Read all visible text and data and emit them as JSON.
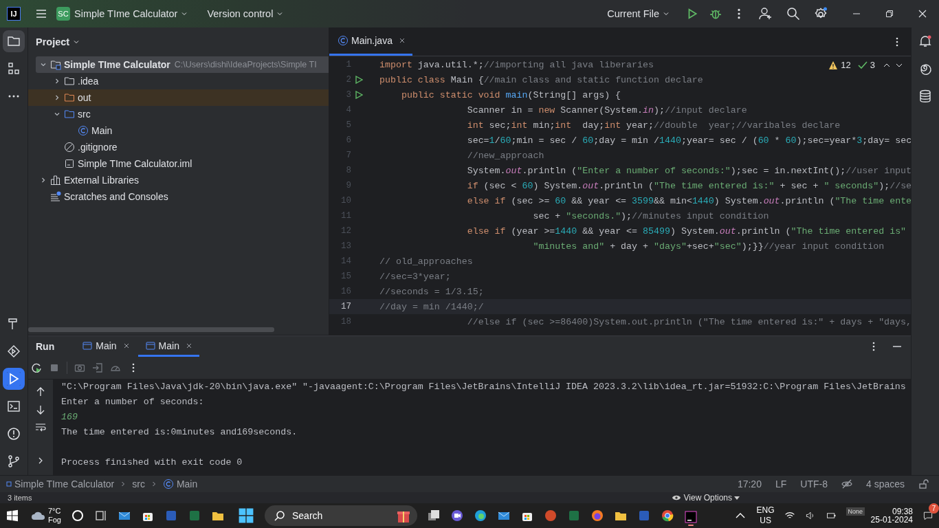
{
  "title_bar": {
    "logo": "IJ",
    "project_badge": "SC",
    "project": "Simple TIme Calculator",
    "vcs": "Version control",
    "run_config": "Current File"
  },
  "project_panel": {
    "title": "Project",
    "tree": [
      {
        "name": "Simple TIme Calculator",
        "path": "C:\\Users\\dishi\\IdeaProjects\\Simple TI",
        "kind": "module-root",
        "expanded": true,
        "selected": true,
        "children": [
          {
            "name": ".idea",
            "kind": "folder",
            "expanded": false,
            "selected": false
          },
          {
            "name": "out",
            "kind": "excluded",
            "expanded": false,
            "selected": false
          },
          {
            "name": "src",
            "kind": "source",
            "expanded": true,
            "selected": false,
            "children": [
              {
                "name": "Main",
                "kind": "class",
                "selected": false
              }
            ]
          },
          {
            "name": ".gitignore",
            "kind": "ignore",
            "selected": false
          },
          {
            "name": "Simple TIme Calculator.iml",
            "kind": "module",
            "selected": false
          }
        ]
      },
      {
        "name": "External Libraries",
        "kind": "libraries",
        "expanded": false,
        "selected": false
      },
      {
        "name": "Scratches and Consoles",
        "kind": "scratches",
        "selected": false
      }
    ]
  },
  "editor": {
    "tabs": [
      {
        "label": "Main.java",
        "selected": true
      }
    ],
    "inspections": {
      "warnings": "12",
      "passed": "3"
    },
    "lines": [
      {
        "n": "1",
        "runnable": false,
        "current": false,
        "tokens": [
          {
            "kind": "kw",
            "t": "import"
          },
          {
            "kind": "id",
            "t": " java.util.*;"
          },
          {
            "kind": "cm",
            "t": "//importing all java liberaries"
          }
        ]
      },
      {
        "n": "2",
        "runnable": true,
        "current": false,
        "tokens": [
          {
            "kind": "kw",
            "t": "public class "
          },
          {
            "kind": "id",
            "t": "Main {"
          },
          {
            "kind": "cm",
            "t": "//main class and static function declare"
          }
        ]
      },
      {
        "n": "3",
        "runnable": true,
        "current": false,
        "tokens": [
          {
            "kind": "kw",
            "t": "    public static void "
          },
          {
            "kind": "fn",
            "t": "main"
          },
          {
            "kind": "id",
            "t": "(String[] args) {"
          }
        ]
      },
      {
        "n": "4",
        "runnable": false,
        "current": false,
        "tokens": [
          {
            "kind": "id",
            "t": "                Scanner in = "
          },
          {
            "kind": "kw",
            "t": "new "
          },
          {
            "kind": "id",
            "t": "Scanner(System."
          },
          {
            "kind": "fld",
            "t": "in"
          },
          {
            "kind": "id",
            "t": ");"
          },
          {
            "kind": "cm",
            "t": "//input declare"
          }
        ]
      },
      {
        "n": "5",
        "runnable": false,
        "current": false,
        "tokens": [
          {
            "kind": "kw",
            "t": "                int "
          },
          {
            "kind": "id",
            "t": "sec;"
          },
          {
            "kind": "kw",
            "t": "int "
          },
          {
            "kind": "id",
            "t": "min;"
          },
          {
            "kind": "kw",
            "t": "int  "
          },
          {
            "kind": "id",
            "t": "day;"
          },
          {
            "kind": "kw",
            "t": "int "
          },
          {
            "kind": "id",
            "t": "year;"
          },
          {
            "kind": "cm",
            "t": "//double  year;//varibales declare"
          }
        ]
      },
      {
        "n": "6",
        "runnable": false,
        "current": false,
        "tokens": [
          {
            "kind": "id",
            "t": "                sec="
          },
          {
            "kind": "num",
            "t": "1"
          },
          {
            "kind": "id",
            "t": "/"
          },
          {
            "kind": "num",
            "t": "60"
          },
          {
            "kind": "id",
            "t": ";min = sec / "
          },
          {
            "kind": "num",
            "t": "60"
          },
          {
            "kind": "id",
            "t": ";day = min /"
          },
          {
            "kind": "num",
            "t": "1440"
          },
          {
            "kind": "id",
            "t": ";year= sec / ("
          },
          {
            "kind": "num",
            "t": "60"
          },
          {
            "kind": "id",
            "t": " * "
          },
          {
            "kind": "num",
            "t": "60"
          },
          {
            "kind": "id",
            "t": ");sec=year*"
          },
          {
            "kind": "num",
            "t": "3"
          },
          {
            "kind": "id",
            "t": ";day= sec"
          }
        ]
      },
      {
        "n": "7",
        "runnable": false,
        "current": false,
        "tokens": [
          {
            "kind": "cm",
            "t": "                //new_approach"
          }
        ]
      },
      {
        "n": "8",
        "runnable": false,
        "current": false,
        "tokens": [
          {
            "kind": "id",
            "t": "                System."
          },
          {
            "kind": "fld",
            "t": "out"
          },
          {
            "kind": "id",
            "t": ".println ("
          },
          {
            "kind": "str",
            "t": "\"Enter a number of seconds:\""
          },
          {
            "kind": "id",
            "t": ");sec = in.nextInt();"
          },
          {
            "kind": "cm",
            "t": "//user input"
          }
        ]
      },
      {
        "n": "9",
        "runnable": false,
        "current": false,
        "tokens": [
          {
            "kind": "kw",
            "t": "                if "
          },
          {
            "kind": "id",
            "t": "(sec < "
          },
          {
            "kind": "num",
            "t": "60"
          },
          {
            "kind": "id",
            "t": ") System."
          },
          {
            "kind": "fld",
            "t": "out"
          },
          {
            "kind": "id",
            "t": ".println ("
          },
          {
            "kind": "str",
            "t": "\"The time entered is:\""
          },
          {
            "kind": "id",
            "t": " + sec + "
          },
          {
            "kind": "str",
            "t": "\" seconds\""
          },
          {
            "kind": "id",
            "t": ");"
          },
          {
            "kind": "cm",
            "t": "//se"
          }
        ]
      },
      {
        "n": "10",
        "runnable": false,
        "current": false,
        "tokens": [
          {
            "kind": "kw",
            "t": "                else if "
          },
          {
            "kind": "id",
            "t": "(sec >= "
          },
          {
            "kind": "num",
            "t": "60"
          },
          {
            "kind": "id",
            "t": " && year <= "
          },
          {
            "kind": "num",
            "t": "3599"
          },
          {
            "kind": "id",
            "t": "&& min<"
          },
          {
            "kind": "num",
            "t": "1440"
          },
          {
            "kind": "id",
            "t": ") System."
          },
          {
            "kind": "fld",
            "t": "out"
          },
          {
            "kind": "id",
            "t": ".println ("
          },
          {
            "kind": "str",
            "t": "\"The time ente"
          }
        ]
      },
      {
        "n": "11",
        "runnable": false,
        "current": false,
        "tokens": [
          {
            "kind": "id",
            "t": "                            sec + "
          },
          {
            "kind": "str",
            "t": "\"seconds.\""
          },
          {
            "kind": "id",
            "t": ");"
          },
          {
            "kind": "cm",
            "t": "//minutes input condition"
          }
        ]
      },
      {
        "n": "12",
        "runnable": false,
        "current": false,
        "tokens": [
          {
            "kind": "kw",
            "t": "                else if "
          },
          {
            "kind": "id",
            "t": "(year >="
          },
          {
            "kind": "num",
            "t": "1440"
          },
          {
            "kind": "id",
            "t": " && year <= "
          },
          {
            "kind": "num",
            "t": "85499"
          },
          {
            "kind": "id",
            "t": ") System."
          },
          {
            "kind": "fld",
            "t": "out"
          },
          {
            "kind": "id",
            "t": ".println ("
          },
          {
            "kind": "str",
            "t": "\"The time entered is\""
          }
        ]
      },
      {
        "n": "13",
        "runnable": false,
        "current": false,
        "tokens": [
          {
            "kind": "str",
            "t": "                            \"minutes and\""
          },
          {
            "kind": "id",
            "t": " + day + "
          },
          {
            "kind": "str",
            "t": "\"days\""
          },
          {
            "kind": "id",
            "t": "+sec+"
          },
          {
            "kind": "str",
            "t": "\"sec\""
          },
          {
            "kind": "id",
            "t": ");}}"
          },
          {
            "kind": "cm",
            "t": "//year input condition"
          }
        ]
      },
      {
        "n": "14",
        "runnable": false,
        "current": false,
        "tokens": [
          {
            "kind": "cm",
            "t": "// old_approaches"
          }
        ]
      },
      {
        "n": "15",
        "runnable": false,
        "current": false,
        "tokens": [
          {
            "kind": "cm",
            "t": "//sec=3*year;"
          }
        ]
      },
      {
        "n": "16",
        "runnable": false,
        "current": false,
        "tokens": [
          {
            "kind": "cm",
            "t": "//seconds = 1/3.15;"
          }
        ]
      },
      {
        "n": "17",
        "runnable": false,
        "current": true,
        "tokens": [
          {
            "kind": "cm",
            "t": "//day = min /1440;/"
          }
        ]
      },
      {
        "n": "18",
        "runnable": false,
        "current": false,
        "tokens": [
          {
            "kind": "cm",
            "t": "                //else if (sec >=86400)System.out.println (\"The time entered is:\" + days + \"days,"
          }
        ]
      }
    ]
  },
  "run_panel": {
    "title": "Run",
    "tabs": [
      {
        "label": "Main",
        "selected": false
      },
      {
        "label": "Main",
        "selected": true
      }
    ],
    "console": [
      {
        "kind": "command",
        "text": "\"C:\\Program Files\\Java\\jdk-20\\bin\\java.exe\" \"-javaagent:C:\\Program Files\\JetBrains\\IntelliJ IDEA 2023.3.2\\lib\\idea_rt.jar=51932:C:\\Program Files\\JetBrains"
      },
      {
        "kind": "output",
        "text": "Enter a number of seconds:"
      },
      {
        "kind": "input",
        "text": "169"
      },
      {
        "kind": "output",
        "text": "The time entered is:0minutes and169seconds."
      },
      {
        "kind": "exit",
        "text": "Process finished with exit code 0"
      }
    ]
  },
  "status_bar": {
    "breadcrumbs": [
      {
        "kind": "module",
        "label": "Simple TIme Calculator"
      },
      {
        "kind": "folder",
        "label": "src"
      },
      {
        "kind": "class",
        "label": "Main"
      }
    ],
    "position": "17:20",
    "line_separator": "LF",
    "encoding": "UTF-8",
    "indent": "4 spaces"
  },
  "taskbar": {
    "status_text": "3 items",
    "weather": {
      "temperature": "7°C",
      "condition": "Fog"
    },
    "search": {
      "placeholder": "Search"
    },
    "view_options": "View Options",
    "language": {
      "code": "ENG",
      "region": "US"
    },
    "focus": "None",
    "clock": {
      "time": "09:38",
      "date": "25-01-2024"
    },
    "notifications": "7"
  }
}
